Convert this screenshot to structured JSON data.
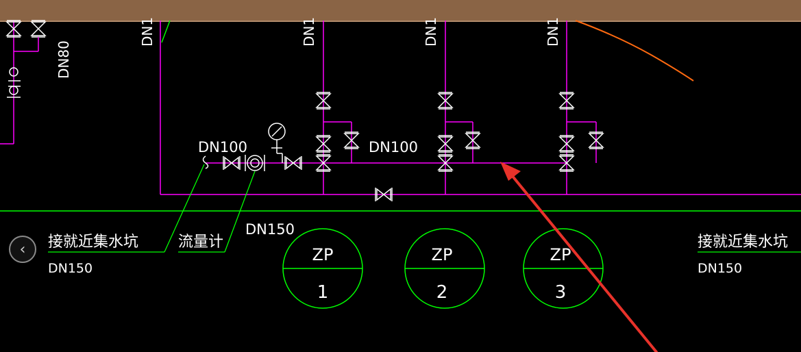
{
  "header": {
    "bar_color": "#8a6445"
  },
  "labels": {
    "dn100_left": "DN100",
    "dn100_mid": "DN100",
    "dn150_main": "DN150",
    "dn150_left": "DN150",
    "dn150_right": "DN150",
    "dn80": "DN80",
    "sump_left": "接就近集水坑",
    "sump_right": "接就近集水坑",
    "flowmeter": "流量计",
    "riser_1": "DN1",
    "riser_2": "DN1",
    "riser_3": "DN1",
    "riser_4": "DN1"
  },
  "pumps": [
    {
      "code": "ZP",
      "number": "1"
    },
    {
      "code": "ZP",
      "number": "2"
    },
    {
      "code": "ZP",
      "number": "3"
    }
  ],
  "navigation": {
    "back_icon": "chevron-left-icon",
    "back_glyph": "‹"
  },
  "colors": {
    "pipe": "#ff00ff",
    "symbol": "#ffffff",
    "green_line": "#00ff00",
    "orange_line": "#ff6a10",
    "arrow": "#e8322a"
  }
}
